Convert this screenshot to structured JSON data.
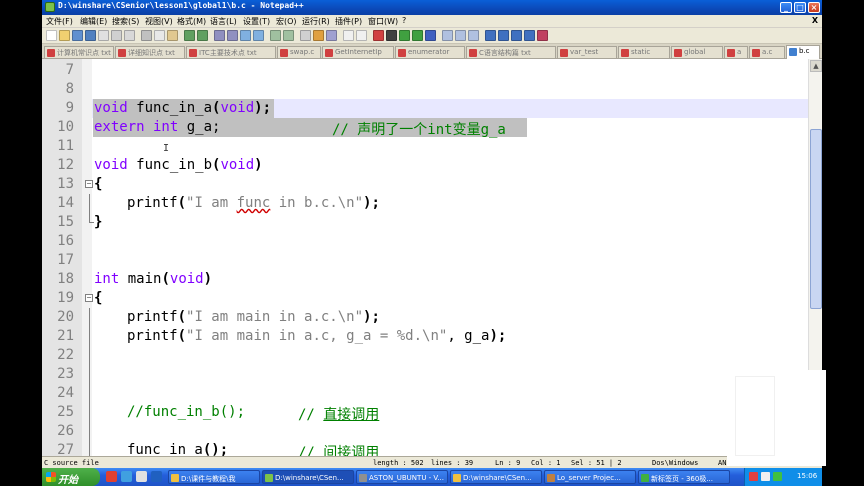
{
  "window": {
    "title": "D:\\winshare\\CSenior\\lesson1\\global1\\b.c - Notepad++",
    "buttons": {
      "minimize": "_",
      "maximize": "□",
      "close": "×"
    }
  },
  "menu": {
    "items": [
      "文件(F)",
      "编辑(E)",
      "搜索(S)",
      "视图(V)",
      "格式(M)",
      "语言(L)",
      "设置(T)",
      "宏(O)",
      "运行(R)",
      "插件(P)",
      "窗口(W)",
      "?"
    ],
    "close": "X"
  },
  "tabs": [
    {
      "label": "计算机常识点 txt",
      "active": false
    },
    {
      "label": "详细知识点 txt",
      "active": false
    },
    {
      "label": "ITC主要技术点 txt",
      "active": false
    },
    {
      "label": "swap.c",
      "active": false
    },
    {
      "label": "GetInternetIp",
      "active": false
    },
    {
      "label": "enumerator",
      "active": false
    },
    {
      "label": "C语言结构篇 txt",
      "active": false
    },
    {
      "label": "var_test",
      "active": false
    },
    {
      "label": "static",
      "active": false
    },
    {
      "label": "global",
      "active": false
    },
    {
      "label": "a",
      "active": false
    },
    {
      "label": "a.c",
      "active": false
    },
    {
      "label": "b.c",
      "active": true
    }
  ],
  "code": {
    "lines": [
      {
        "n": "7"
      },
      {
        "n": "8"
      },
      {
        "n": "9"
      },
      {
        "n": "10"
      },
      {
        "n": "11"
      },
      {
        "n": "12"
      },
      {
        "n": "13"
      },
      {
        "n": "14"
      },
      {
        "n": "15"
      },
      {
        "n": "16"
      },
      {
        "n": "17"
      },
      {
        "n": "18"
      },
      {
        "n": "19"
      },
      {
        "n": "20"
      },
      {
        "n": "21"
      },
      {
        "n": "22"
      },
      {
        "n": "23"
      },
      {
        "n": "24"
      },
      {
        "n": "25"
      },
      {
        "n": "26"
      },
      {
        "n": "27"
      }
    ],
    "tokens": {
      "l9_void": "void",
      "l9_name": " func_in_a",
      "l9_open": "(",
      "l9_arg": "void",
      "l9_close": ");",
      "l10_extern": "extern",
      "l10_int": " int",
      "l10_rest": " g_a;",
      "l10_comment": "// 声明了一个int变量g_a",
      "l12_void": "void",
      "l12_name": " func_in_b",
      "l12_open": "(",
      "l12_arg": "void",
      "l12_close": ")",
      "l13_brace": "{",
      "l14_fn": "printf",
      "l14_open": "(",
      "l14_s1": "\"I am ",
      "l14_s2": "func",
      "l14_s3": " in b.c.\\n\"",
      "l14_close": ");",
      "l15_brace": "}",
      "l18_int": "int",
      "l18_name": " main",
      "l18_open": "(",
      "l18_arg": "void",
      "l18_close": ")",
      "l19_brace": "{",
      "l20_fn": "printf",
      "l20_open": "(",
      "l20_str": "\"I am main in a.c.\\n\"",
      "l20_close": ");",
      "l21_fn": "printf",
      "l21_open": "(",
      "l21_str": "\"I am main in a.c, g_a = %d.\\n\"",
      "l21_rest": ", g_a",
      "l21_close": ");",
      "l25_comment": "//func_in_b();",
      "l25_comment2": "// ",
      "l25_comment3": "直接调用",
      "l27_name": "func_in_a",
      "l27_close": "();",
      "l27_comment": "// ",
      "l27_comment3": "间接调用"
    }
  },
  "status": {
    "filetype": "C source file",
    "length": "length : 502",
    "lines": "lines : 39",
    "ln": "Ln : 9",
    "col": "Col : 1",
    "sel": "Sel : 51 | 2",
    "eol": "Dos\\Windows",
    "enc": "AN"
  },
  "taskbar": {
    "start": "开始",
    "tasks": [
      {
        "label": "D:\\课件与教程\\我",
        "active": false
      },
      {
        "label": "D:\\winshare\\CSen...",
        "active": true
      },
      {
        "label": "ASTON_UBUNTU - V...",
        "active": false
      },
      {
        "label": "D:\\winshare\\CSen...",
        "active": false
      },
      {
        "label": "Lo_server Projec...",
        "active": false
      },
      {
        "label": "新标签页 - 360极...",
        "active": false
      }
    ],
    "clock": "15:06"
  },
  "colors": {
    "keyword": "#8000ff",
    "string": "#808080",
    "comment": "#008000",
    "selection": "#c0c0c0",
    "titlebar": "#0b49b8"
  }
}
